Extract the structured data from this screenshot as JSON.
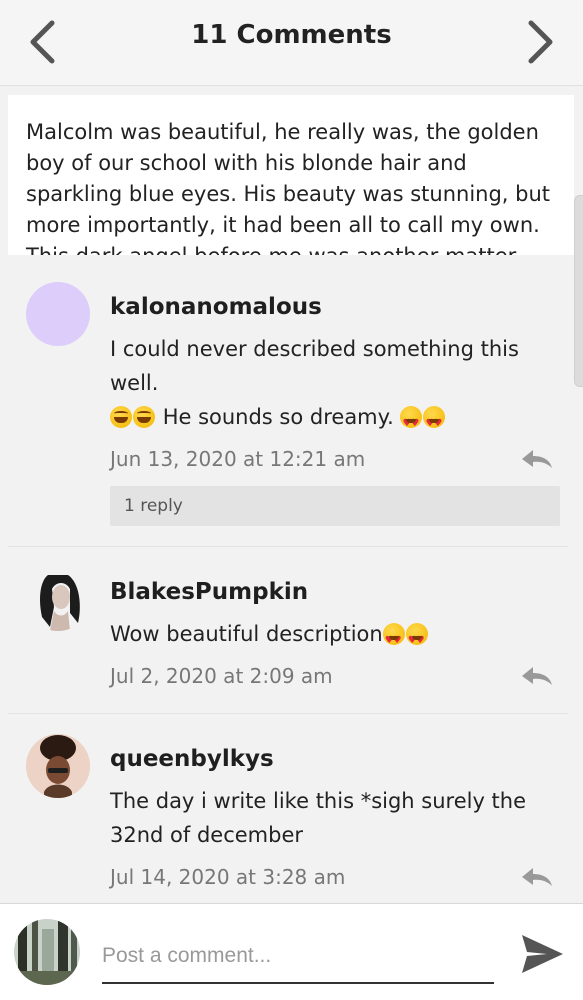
{
  "header": {
    "title": "11 Comments",
    "back_icon": "chevron-left-icon",
    "forward_icon": "chevron-right-icon"
  },
  "excerpt": {
    "text": "Malcolm was beautiful, he really was, the golden boy of our school with his blonde hair and sparkling blue eyes. His beauty was stunning, but more importantly, it had been all to call my own. This dark angel before me was another matter."
  },
  "comments": [
    {
      "username": "kalonanomalous",
      "text_line1": "I could never described something this well.",
      "text_line2": "He sounds so dreamy.",
      "timestamp": "Jun 13, 2020 at 12:21 am",
      "replies_label": "1 reply",
      "avatar_color": "#dccdfb"
    },
    {
      "username": "BlakesPumpkin",
      "text": "Wow beautiful description",
      "timestamp": "Jul 2, 2020 at 2:09 am"
    },
    {
      "username": "queenbylkys",
      "text": "The day i write like this *sigh surely the 32nd of december",
      "timestamp": "Jul 14, 2020 at 3:28 am"
    }
  ],
  "composer": {
    "placeholder": "Post a comment..."
  },
  "colors": {
    "text": "#222222",
    "muted": "#777777",
    "icon": "#999999"
  }
}
